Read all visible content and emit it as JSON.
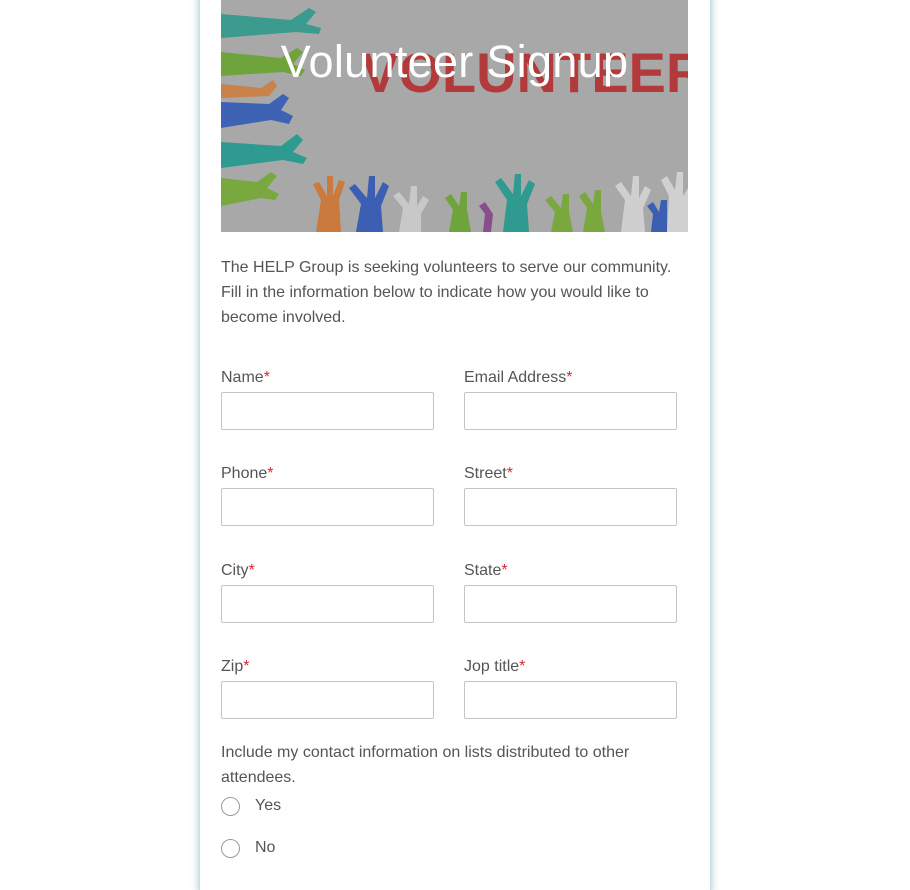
{
  "header": {
    "title": "Volunteer Signup",
    "banner_text": "VOLUNTEER"
  },
  "intro": "The HELP Group is seeking volunteers to serve our community. Fill in the information below to indicate how you would like to become involved.",
  "required_marker": "*",
  "fields": [
    {
      "label": "Name",
      "required": true,
      "value": ""
    },
    {
      "label": "Email Address",
      "required": true,
      "value": ""
    },
    {
      "label": "Phone",
      "required": true,
      "value": ""
    },
    {
      "label": "Street",
      "required": true,
      "value": ""
    },
    {
      "label": "City",
      "required": true,
      "value": ""
    },
    {
      "label": "State",
      "required": true,
      "value": ""
    },
    {
      "label": "Zip",
      "required": true,
      "value": ""
    },
    {
      "label": "Jop title",
      "required": true,
      "value": ""
    }
  ],
  "contact_question": {
    "text": "Include my contact information on lists distributed to other attendees.",
    "options": [
      {
        "label": "Yes",
        "selected": false
      },
      {
        "label": "No",
        "selected": false
      }
    ]
  },
  "colors": {
    "required": "#e0262a",
    "text": "#555555",
    "panel_shadow": "#7aaab2"
  }
}
